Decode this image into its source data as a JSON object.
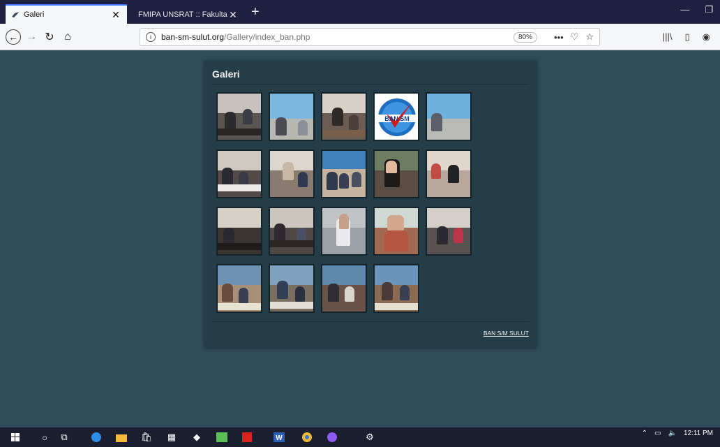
{
  "browser": {
    "tabs": [
      {
        "title": "Galeri",
        "active": true
      },
      {
        "title": "FMIPA UNSRAT :: Fakultas MIPA",
        "active": false
      }
    ],
    "new_tab": "+",
    "url_host": "ban-sm-sulut.org",
    "url_path": "/Gallery/index_ban.php",
    "zoom": "80%",
    "menu_dots": "•••"
  },
  "page": {
    "title": "Galeri",
    "footer_link": "BAN S/M SULUT",
    "logo_text": "BAN SM",
    "thumbnail_count": 19,
    "grid": {
      "columns": 5,
      "rows": 4
    }
  },
  "taskbar": {
    "time": "12:11 PM"
  },
  "colors": {
    "page_bg": "#2f4b5a",
    "card_bg": "#253d49",
    "tab_strip": "#1f1f3f",
    "accent": "#3c78ff"
  }
}
